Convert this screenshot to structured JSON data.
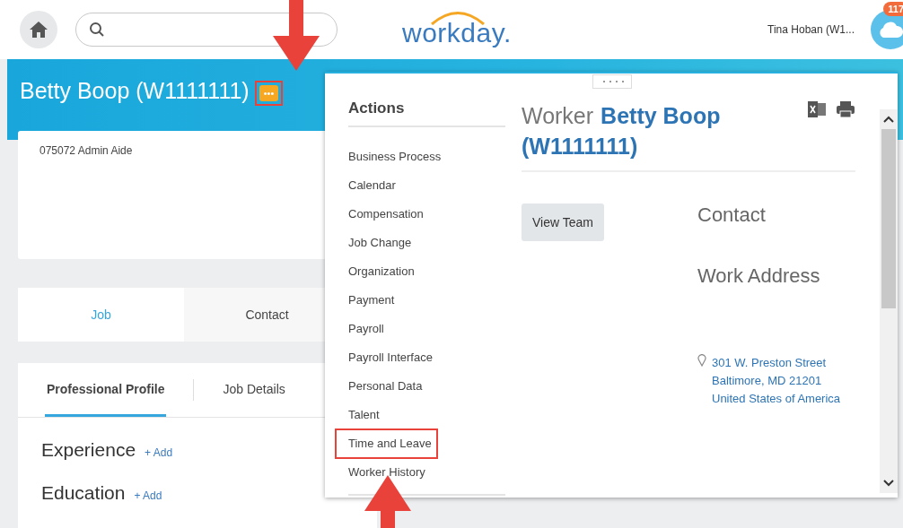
{
  "top_bar": {
    "logo": "workday.",
    "user": "Tina Hoban  (W1...",
    "notification_count": "117"
  },
  "header": {
    "title": "Betty Boop (W1111111)",
    "more_button": {
      "label": "•••",
      "annotated": true
    }
  },
  "card": {
    "position": "075072 Admin Aide"
  },
  "tabs": [
    {
      "label": "Job",
      "selected": true
    },
    {
      "label": "Contact",
      "selected": false
    }
  ],
  "subtabs": [
    {
      "label": "Professional Profile",
      "selected": true
    },
    {
      "label": "Job Details",
      "selected": false
    }
  ],
  "sections": [
    {
      "title": "Experience",
      "add": "+ Add"
    },
    {
      "title": "Education",
      "add": "+ Add"
    }
  ],
  "popup": {
    "actions_title": "Actions",
    "actions": [
      {
        "label": "Business Process",
        "annotated": false
      },
      {
        "label": "Calendar",
        "annotated": false
      },
      {
        "label": "Compensation",
        "annotated": false
      },
      {
        "label": "Job Change",
        "annotated": false
      },
      {
        "label": "Organization",
        "annotated": false
      },
      {
        "label": "Payment",
        "annotated": false
      },
      {
        "label": "Payroll",
        "annotated": false
      },
      {
        "label": "Payroll Interface",
        "annotated": false
      },
      {
        "label": "Personal Data",
        "annotated": false
      },
      {
        "label": "Talent",
        "annotated": false
      },
      {
        "label": "Time and Leave",
        "annotated": true
      },
      {
        "label": "Worker History",
        "annotated": false
      }
    ],
    "worker_label": "Worker",
    "worker_name": "Betty Boop (W1111111)",
    "view_team": "View Team",
    "contact_title": "Contact",
    "work_address_title": "Work Address",
    "address": [
      "301 W. Preston Street",
      "Baltimore, MD 21201",
      "United States of America"
    ]
  }
}
